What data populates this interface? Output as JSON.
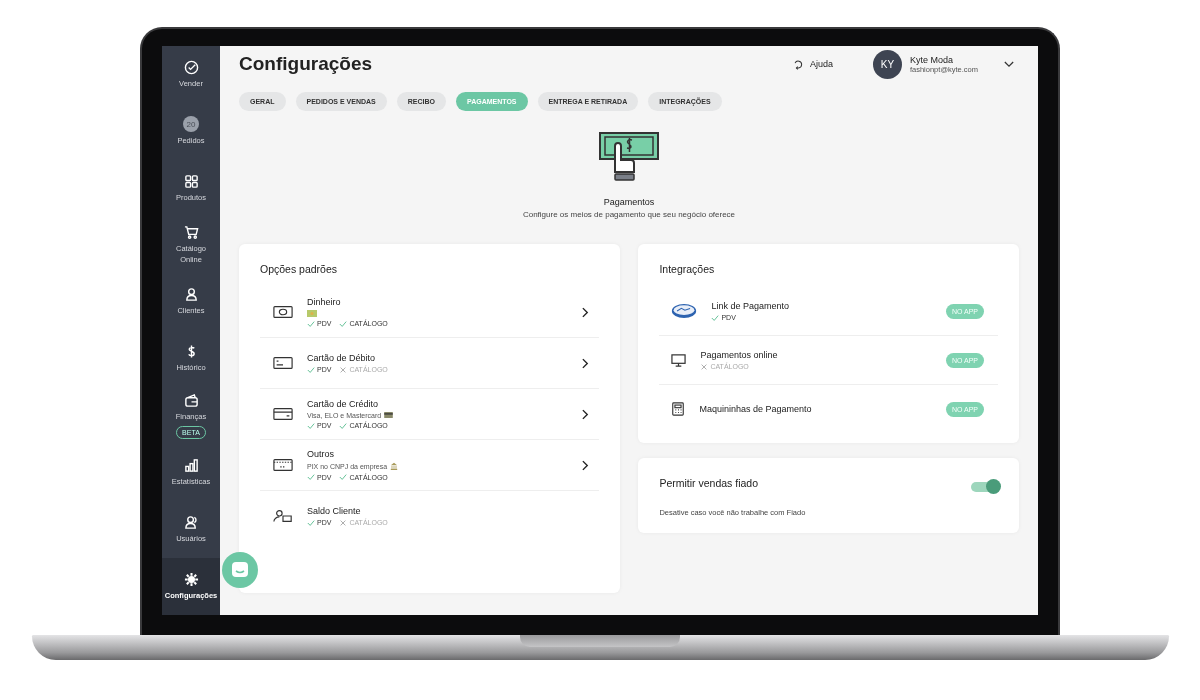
{
  "sidebar": {
    "items": [
      {
        "label": "Vender",
        "selected": false
      },
      {
        "label": "Pedidos",
        "badge": "20",
        "selected": false
      },
      {
        "label": "Produtos",
        "selected": false
      },
      {
        "label": "Catálogo Online",
        "selected": false
      },
      {
        "label": "Clientes",
        "selected": false
      },
      {
        "label": "Histórico",
        "selected": false
      },
      {
        "label": "Finanças",
        "tag": "BETA",
        "selected": false
      },
      {
        "label": "Estatísticas",
        "selected": false
      },
      {
        "label": "Usuários",
        "selected": false
      },
      {
        "label": "Configurações",
        "selected": true
      }
    ]
  },
  "header": {
    "title": "Configurações",
    "help": "Ajuda",
    "user": {
      "initials": "KY",
      "name": "Kyte Moda",
      "email": "fashionpt@kyte.com"
    }
  },
  "tabs": [
    {
      "label": "GERAL",
      "selected": false
    },
    {
      "label": "PEDIDOS E VENDAS",
      "selected": false
    },
    {
      "label": "RECIBO",
      "selected": false
    },
    {
      "label": "PAGAMENTOS",
      "selected": true
    },
    {
      "label": "ENTREGA E RETIRADA",
      "selected": false
    },
    {
      "label": "INTEGRAÇÕES",
      "selected": false
    }
  ],
  "intro": {
    "title": "Pagamentos",
    "subtitle": "Configure os meios de pagamento que seu negócio oferece"
  },
  "default_options": {
    "title": "Opções padrões",
    "items": [
      {
        "name": "Dinheiro",
        "tags": [
          {
            "label": "PDV",
            "on": true
          },
          {
            "label": "CATÁLOGO",
            "on": true
          }
        ],
        "arrow": true
      },
      {
        "name": "Cartão de Débito",
        "tags": [
          {
            "label": "PDV",
            "on": true
          },
          {
            "label": "CATÁLOGO",
            "on": false
          }
        ],
        "arrow": true
      },
      {
        "name": "Cartão de Crédito",
        "note": "Visa, ELO e Mastercard",
        "tags": [
          {
            "label": "PDV",
            "on": true
          },
          {
            "label": "CATÁLOGO",
            "on": true
          }
        ],
        "arrow": true
      },
      {
        "name": "Outros",
        "note": "PIX no CNPJ da empresa",
        "tags": [
          {
            "label": "PDV",
            "on": true
          },
          {
            "label": "CATÁLOGO",
            "on": true
          }
        ],
        "arrow": true
      },
      {
        "name": "Saldo Cliente",
        "tags": [
          {
            "label": "PDV",
            "on": true
          },
          {
            "label": "CATÁLOGO",
            "on": false
          }
        ],
        "arrow": false
      }
    ]
  },
  "integrations": {
    "title": "Integrações",
    "items": [
      {
        "name": "Link de Pagamento",
        "tags": [
          {
            "label": "PDV",
            "on": true
          }
        ],
        "badge": "NO APP"
      },
      {
        "name": "Pagamentos online",
        "tags": [
          {
            "label": "CATÁLOGO",
            "on": false
          }
        ],
        "badge": "NO APP"
      },
      {
        "name": "Maquininhas de Pagamento",
        "badge": "NO APP"
      }
    ]
  },
  "fiado": {
    "title": "Permitir vendas fiado",
    "description": "Desative caso você não trabalhe com Fiado",
    "on": true
  }
}
